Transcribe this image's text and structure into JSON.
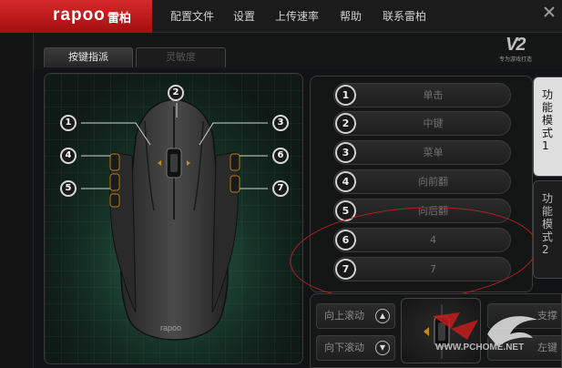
{
  "app": {
    "brand": "rapoo",
    "brand_cn": "雷柏",
    "right_logo": "V2",
    "slogan": "专为游戏打造"
  },
  "menu": [
    "配置文件",
    "设置",
    "上传速率",
    "帮助",
    "联系雷柏"
  ],
  "tabs": [
    {
      "label": "按键指派",
      "active": true
    },
    {
      "label": "灵敏度",
      "active": false
    }
  ],
  "mouse_callouts": [
    "1",
    "2",
    "3",
    "4",
    "5",
    "6",
    "7"
  ],
  "mouse_logo": "rapoo",
  "functions": [
    {
      "num": "1",
      "label": "单击"
    },
    {
      "num": "2",
      "label": "中键"
    },
    {
      "num": "3",
      "label": "菜单"
    },
    {
      "num": "4",
      "label": "向前翻"
    },
    {
      "num": "5",
      "label": "向后翻"
    },
    {
      "num": "6",
      "label": "4"
    },
    {
      "num": "7",
      "label": "7"
    }
  ],
  "mode_tabs": [
    {
      "label": "功能模式1",
      "active": true
    },
    {
      "label": "功能模式2",
      "active": false
    }
  ],
  "scroll": {
    "up_label": "向上滚动",
    "down_label": "向下滚动",
    "right_top": "支撑",
    "right_bottom": "左键"
  },
  "watermark": "WWW.PCHOME.NET",
  "colors": {
    "accent_red": "#c41d1d",
    "panel_green": "#1e4b3c",
    "highlight_ellipse": "#b52020"
  }
}
